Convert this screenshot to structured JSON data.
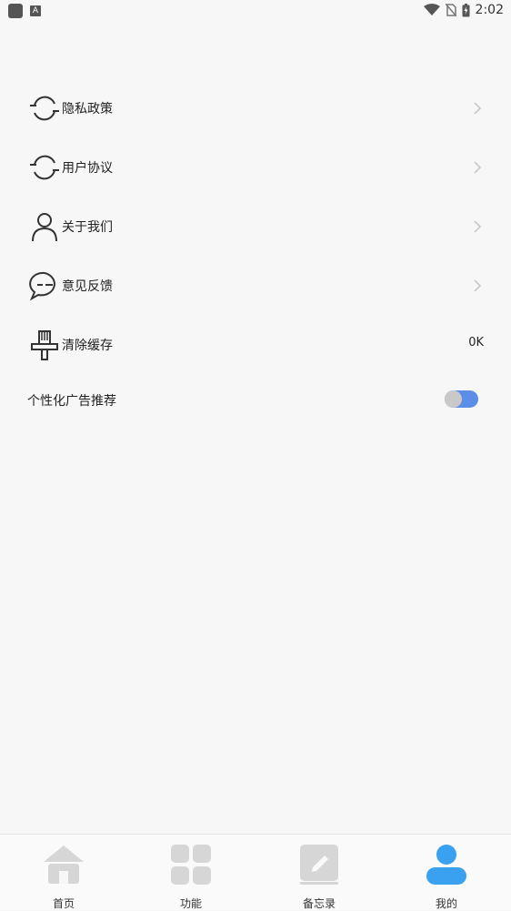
{
  "status_bar": {
    "time": "2:02",
    "left_icons": [
      "app-square-icon",
      "a-badge-icon"
    ],
    "right_icons": [
      "wifi-icon",
      "no-sim-icon",
      "battery-charging-icon"
    ]
  },
  "menu": {
    "items": [
      {
        "label": "隐私政策",
        "icon": "refresh-cycle-icon",
        "has_chevron": true
      },
      {
        "label": "用户协议",
        "icon": "refresh-cycle-icon",
        "has_chevron": true
      },
      {
        "label": "关于我们",
        "icon": "user-icon",
        "has_chevron": true
      },
      {
        "label": "意见反馈",
        "icon": "chat-bubble-icon",
        "has_chevron": true
      },
      {
        "label": "清除缓存",
        "icon": "brush-icon",
        "value": "0K"
      }
    ],
    "toggle": {
      "label": "个性化广告推荐",
      "state": "on"
    }
  },
  "bottom_nav": {
    "items": [
      {
        "label": "首页",
        "icon": "home-icon",
        "active": false
      },
      {
        "label": "功能",
        "icon": "grid-icon",
        "active": false
      },
      {
        "label": "备忘录",
        "icon": "memo-icon",
        "active": false
      },
      {
        "label": "我的",
        "icon": "profile-icon",
        "active": true
      }
    ]
  },
  "colors": {
    "background": "#f7f7f7",
    "accent": "#3aa0f0",
    "toggle_on": "#5b8ee6",
    "inactive_icon": "#d6d6d6"
  }
}
